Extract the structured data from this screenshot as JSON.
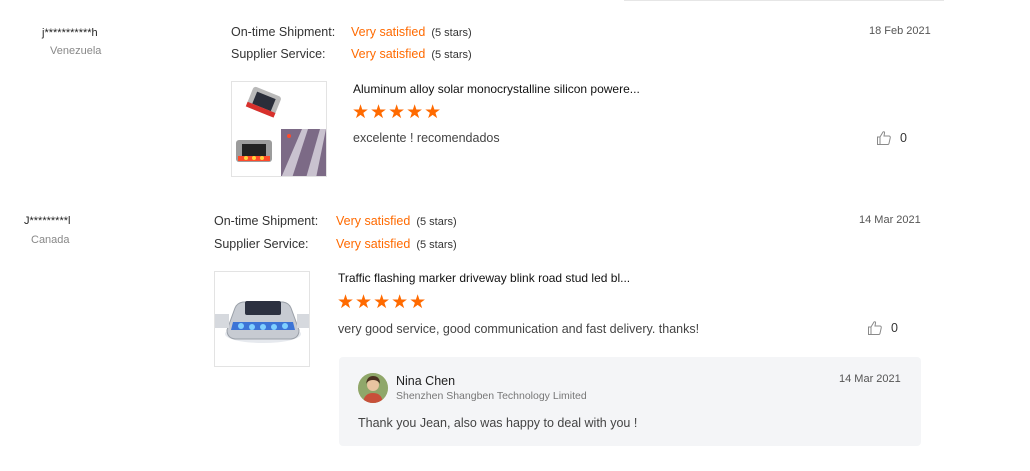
{
  "reviews": [
    {
      "buyer": "j***********h",
      "country": "Venezuela",
      "shipment_label": "On-time Shipment:",
      "shipment_value": "Very satisfied",
      "shipment_stars": "(5 stars)",
      "service_label": "Supplier Service:",
      "service_value": "Very satisfied",
      "service_stars": "(5 stars)",
      "date": "18 Feb 2021",
      "product_title": "Aluminum alloy solar monocrystalline silicon powere...",
      "rating": 5,
      "stars": "★★★★★",
      "comment": "excelente ! recomendados",
      "likes": "0",
      "thumb_icon": "solar-road-stud-product-image"
    },
    {
      "buyer": "J*********l",
      "country": "Canada",
      "shipment_label": "On-time Shipment:",
      "shipment_value": "Very satisfied",
      "shipment_stars": "(5 stars)",
      "service_label": "Supplier Service:",
      "service_value": "Very satisfied",
      "service_stars": "(5 stars)",
      "date": "14 Mar 2021",
      "product_title": "Traffic flashing marker driveway blink road stud led bl...",
      "rating": 5,
      "stars": "★★★★★",
      "comment": "very good service, good communication and fast delivery. thanks!",
      "likes": "0",
      "thumb_icon": "led-road-stud-product-image",
      "reply": {
        "name": "Nina Chen",
        "company": "Shenzhen Shangben Technology Limited",
        "date": "14 Mar 2021",
        "text": "Thank you Jean, also was happy to deal with you !"
      }
    }
  ],
  "colors": {
    "accent": "#ff6a00",
    "reply_bg": "#f4f5f7",
    "text": "#333333"
  }
}
